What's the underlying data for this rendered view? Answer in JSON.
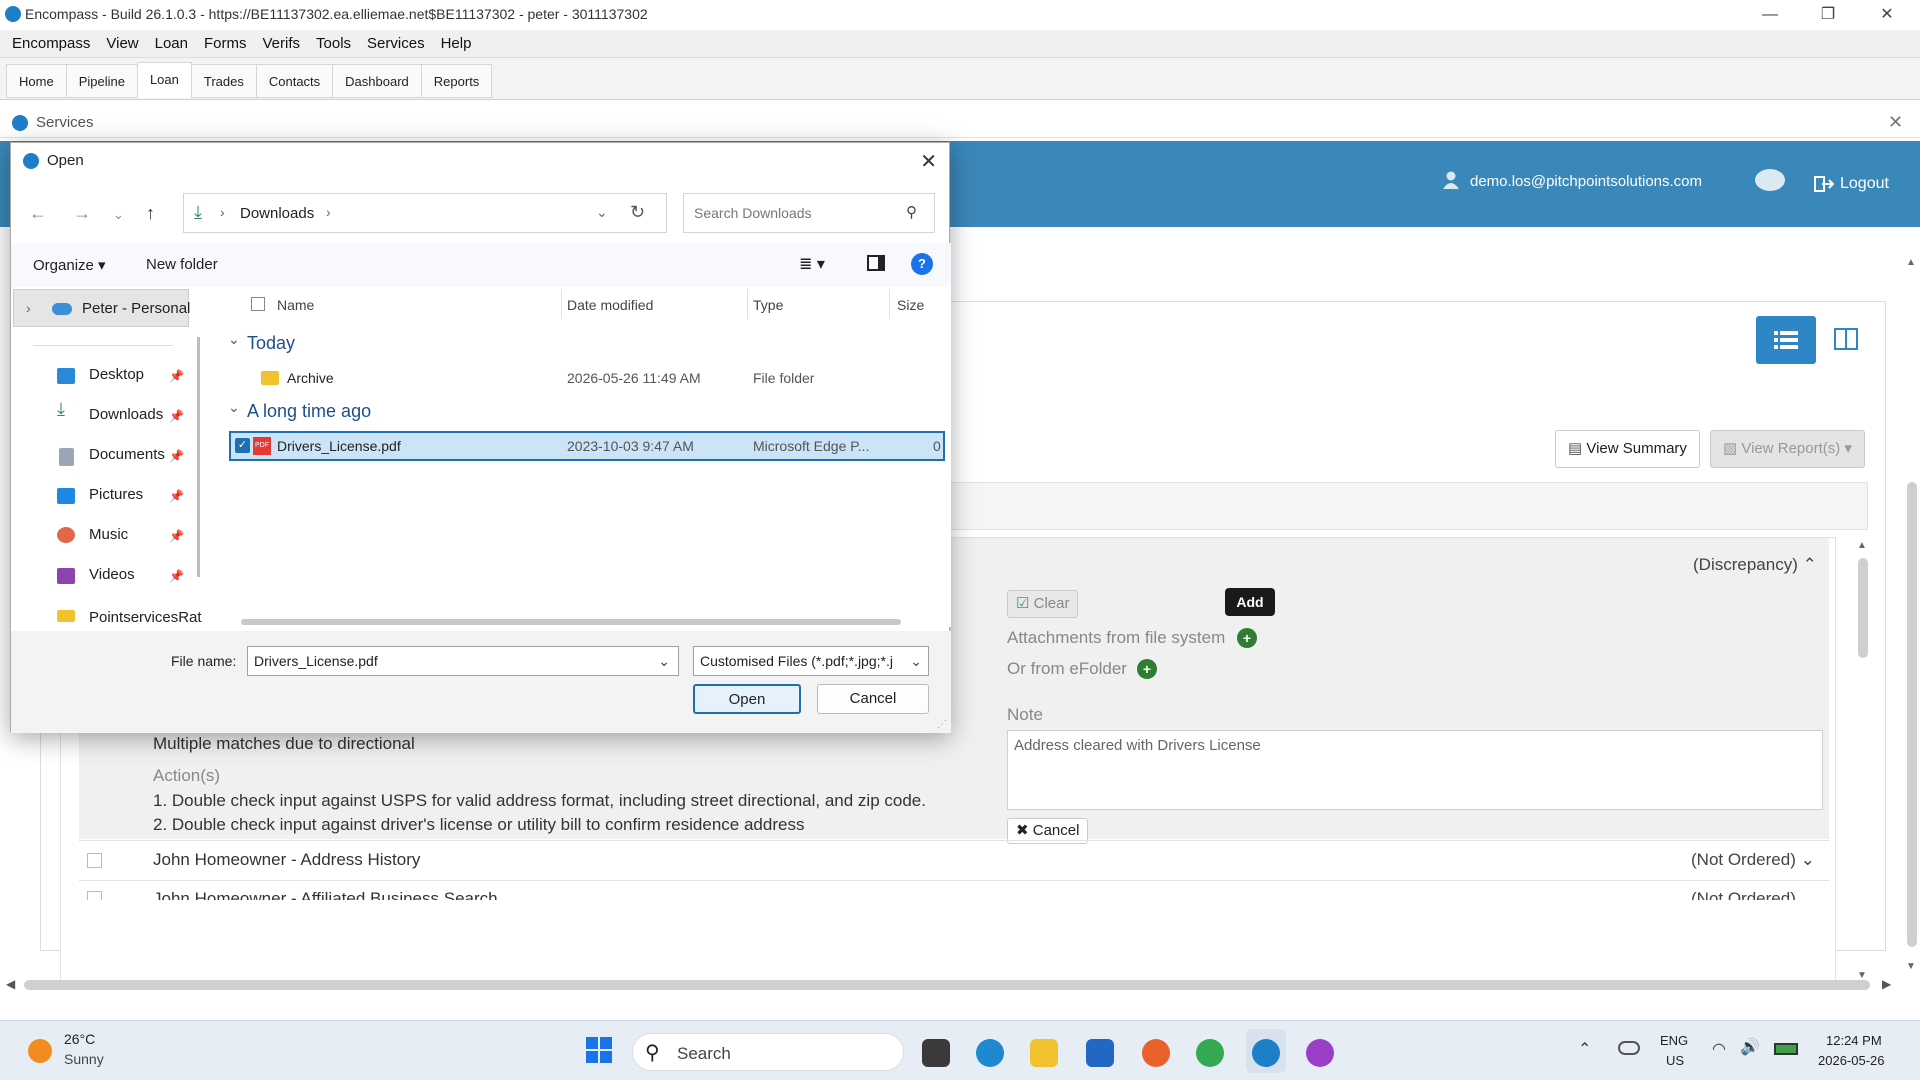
{
  "window": {
    "title": "Encompass - Build 26.1.0.3 - https://BE11137302.ea.elliemae.net$BE11137302 - peter - 3011137302",
    "minimize_glyph": "—",
    "restore_glyph": "❐",
    "close_glyph": "✕"
  },
  "menubar": [
    "Encompass",
    "View",
    "Loan",
    "Forms",
    "Verifs",
    "Tools",
    "Services",
    "Help"
  ],
  "tabs": [
    "Home",
    "Pipeline",
    "Loan",
    "Trades",
    "Contacts",
    "Dashboard",
    "Reports"
  ],
  "active_tab": "Loan",
  "services_window": {
    "title": "Services",
    "close_glyph": "✕"
  },
  "header": {
    "user_email": "demo.los@pitchpointsolutions.com",
    "logout_label": "Logout"
  },
  "toolbar": {
    "view_summary_label": "View Summary",
    "view_reports_label": "View Report(s)"
  },
  "discrepancy": {
    "status_label": "(Discrepancy)",
    "clear_label": "Clear",
    "add_tooltip": "Add",
    "attachments_label": "Attachments from file system",
    "efolder_label": "Or from eFolder",
    "note_label": "Note",
    "note_value": "Address cleared with Drivers License",
    "cancel_label": "Cancel",
    "issue_text": "Multiple matches due to directional",
    "actions_label": "Action(s)",
    "action_1": "1. Double check input against USPS for valid address format, including street directional, and zip code.",
    "action_2": "2. Double check input against driver's license or utility bill to confirm residence address"
  },
  "orders": [
    {
      "name": "John Homeowner - Address History",
      "status": "(Not Ordered)"
    },
    {
      "name": "John Homeowner - Affiliated Business Search",
      "status": "(Not Ordered)"
    }
  ],
  "dialog": {
    "title": "Open",
    "close_glyph": "✕",
    "breadcrumb": "Downloads",
    "search_placeholder": "Search Downloads",
    "organize_label": "Organize",
    "new_folder_label": "New folder",
    "help_glyph": "?",
    "nav_root": "Peter - Personal",
    "nav_items": [
      "Desktop",
      "Downloads",
      "Documents",
      "Pictures",
      "Music",
      "Videos",
      "PointservicesRat"
    ],
    "columns": [
      "Name",
      "Date modified",
      "Type",
      "Size"
    ],
    "groups": [
      "Today",
      "A long time ago"
    ],
    "files": [
      {
        "name": "Archive",
        "date": "2026-05-26 11:49 AM",
        "type": "File folder",
        "size": ""
      },
      {
        "name": "Drivers_License.pdf",
        "date": "2023-10-03 9:47 AM",
        "type": "Microsoft Edge P...",
        "size": "0"
      }
    ],
    "file_name_label": "File name:",
    "file_name_value": "Drivers_License.pdf",
    "file_type_value": "Customised Files (*.pdf;*.jpg;*.j",
    "open_label": "Open",
    "cancel_label": "Cancel"
  },
  "taskbar": {
    "weather_temp": "26°C",
    "weather_desc": "Sunny",
    "search_label": "Search",
    "lang_top": "ENG",
    "lang_bottom": "US",
    "time": "12:24 PM",
    "date": "2026-05-26"
  },
  "colors": {
    "header_blue": "#3a87b9",
    "accent_blue": "#1f6fb5",
    "selection": "#cce4f7",
    "green_add": "#2e7d32"
  }
}
